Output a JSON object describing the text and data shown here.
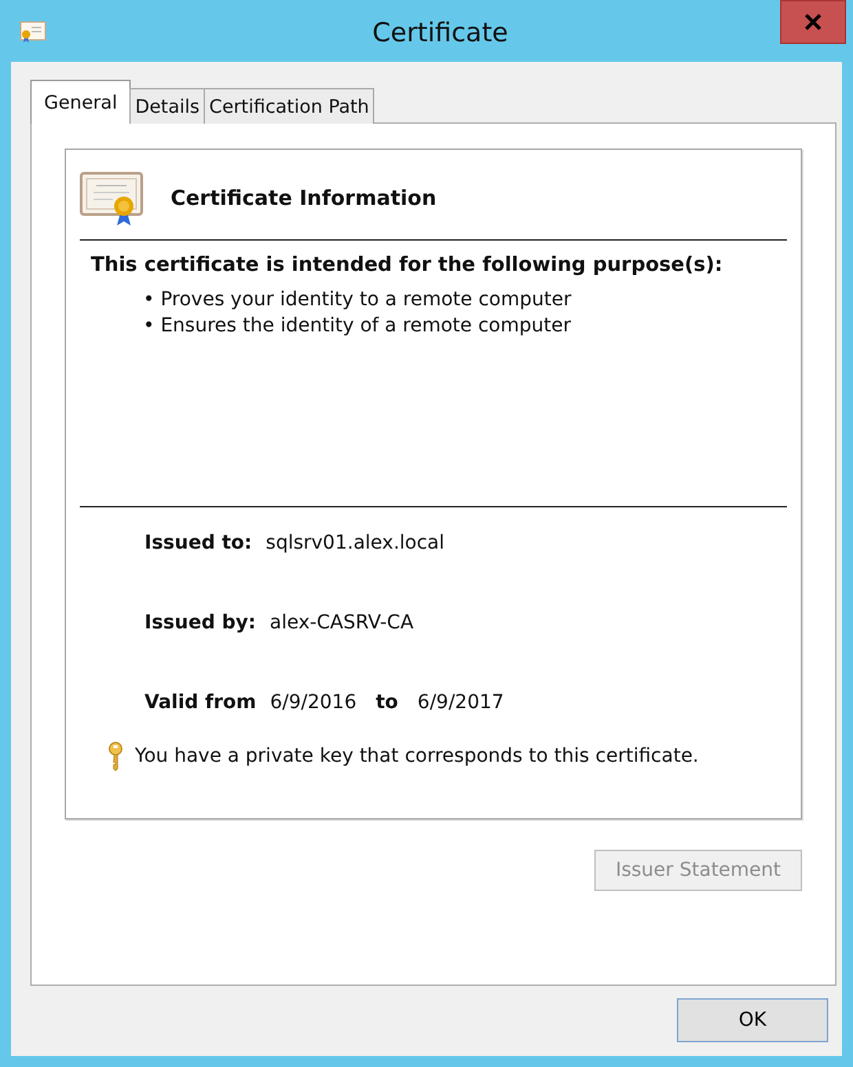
{
  "window": {
    "title": "Certificate"
  },
  "tabs": [
    {
      "label": "General",
      "selected": true
    },
    {
      "label": "Details",
      "selected": false
    },
    {
      "label": "Certification Path",
      "selected": false
    }
  ],
  "info": {
    "heading": "Certificate Information",
    "purpose_title": "This certificate is intended for the following purpose(s):",
    "purposes": [
      "• Proves your identity to a remote computer",
      "• Ensures the identity of a remote computer"
    ],
    "issued_to_label": "Issued to:",
    "issued_to": "sqlsrv01.alex.local",
    "issued_by_label": "Issued by:",
    "issued_by": "alex-CASRV-CA",
    "valid_from_label": "Valid from",
    "valid_from": "6/9/2016",
    "to_label": "to",
    "valid_to": "6/9/2017",
    "key_note": "You have a private key that corresponds to this certificate."
  },
  "buttons": [
    {
      "label": "Issuer Statement",
      "disabled": true
    },
    {
      "label": "OK",
      "disabled": false
    }
  ]
}
